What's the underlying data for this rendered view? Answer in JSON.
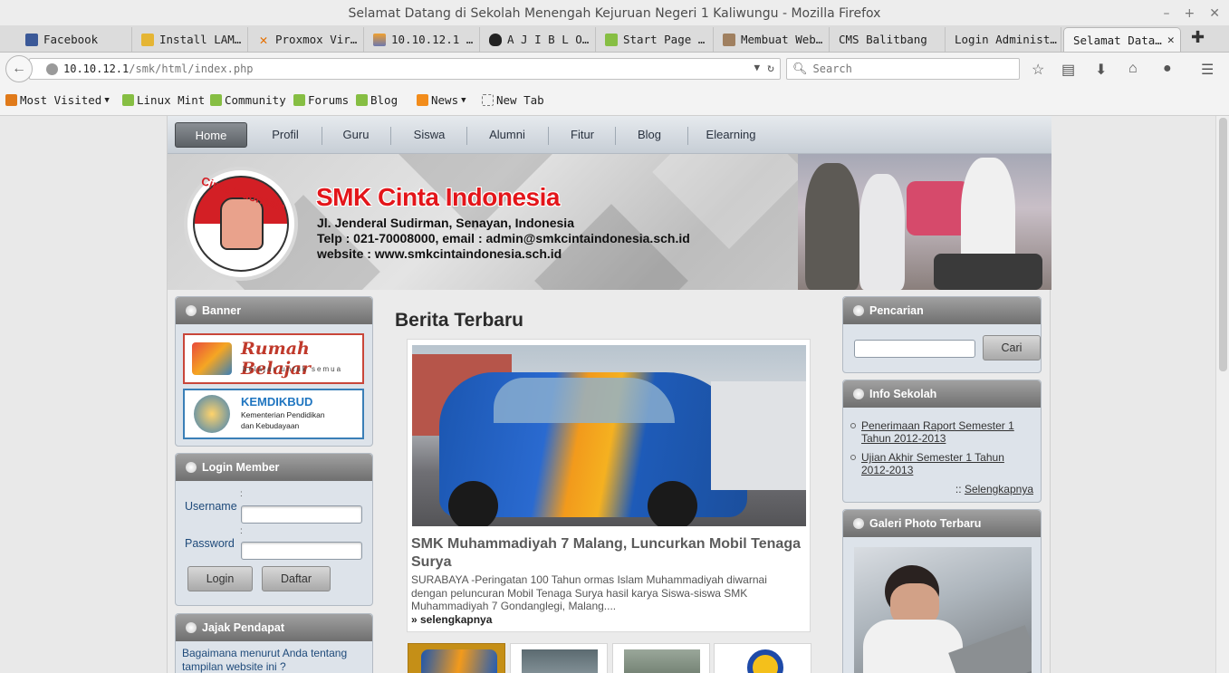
{
  "window": {
    "title": "Selamat Datang di Sekolah Menengah Kejuruan Negeri 1 Kaliwungu - Mozilla Firefox"
  },
  "tabs": [
    {
      "label": "Facebook",
      "icon": "facebook-icon",
      "color": "#3b5998"
    },
    {
      "label": "Install LAM…",
      "icon": "person-icon",
      "color": "#e5b534"
    },
    {
      "label": "Proxmox Vir…",
      "icon": "proxmox-icon",
      "color": "#e57000"
    },
    {
      "label": "10.10.12.1 …",
      "icon": "pma-icon",
      "color": "#f0a030"
    },
    {
      "label": "A J I B L O…",
      "icon": "tux-icon",
      "color": "#333333"
    },
    {
      "label": "Start Page …",
      "icon": "mint-icon",
      "color": "#86be43"
    },
    {
      "label": "Membuat Web…",
      "icon": "page-icon",
      "color": "#a08060"
    },
    {
      "label": "CMS Balitbang",
      "icon": "",
      "color": ""
    },
    {
      "label": "Login Administ…",
      "icon": "",
      "color": ""
    },
    {
      "label": "Selamat Data…",
      "icon": "",
      "color": ""
    }
  ],
  "navbar": {
    "url_host": "10.10.12.1",
    "url_path": "/smk/html/index.php",
    "search_placeholder": "Search"
  },
  "bookmarks": [
    {
      "label": "Most Visited",
      "icon": "most-visited-icon",
      "dropdown": true
    },
    {
      "label": "Linux Mint",
      "icon": "mint-icon",
      "dropdown": false
    },
    {
      "label": "Community",
      "icon": "mint-icon",
      "dropdown": false
    },
    {
      "label": "Forums",
      "icon": "mint-icon",
      "dropdown": false
    },
    {
      "label": "Blog",
      "icon": "mint-icon",
      "dropdown": false
    },
    {
      "label": "News",
      "icon": "rss-icon",
      "dropdown": true
    },
    {
      "label": "New Tab",
      "icon": "new-tab-icon",
      "dropdown": false
    }
  ],
  "site": {
    "menu": [
      "Home",
      "Profil",
      "Guru",
      "Siswa",
      "Alumni",
      "Fitur",
      "Blog",
      "Elearning"
    ],
    "active_menu": "Home",
    "header": {
      "logo_text": "Cinta Indonesia",
      "name": "SMK Cinta Indonesia",
      "address": "Jl. Jenderal Sudirman, Senayan, Indonesia",
      "contact": "Telp : 021-70008000, email : admin@smkcintaindonesia.sch.id",
      "website": "website : www.smkcintaindonesia.sch.id"
    },
    "banner_panel": {
      "title": "Banner",
      "rumah_belajar": {
        "title": "Rumah Belajar",
        "subtitle": "belajar untuk semua"
      },
      "kemdikbud": {
        "title": "KEMDIKBUD",
        "line1": "Kementerian Pendidikan",
        "line2": "dan Kebudayaan"
      }
    },
    "login_panel": {
      "title": "Login Member",
      "username_label": "Username",
      "password_label": "Password",
      "colon": ":",
      "login_button": "Login",
      "register_button": "Daftar"
    },
    "poll_panel": {
      "title": "Jajak Pendapat",
      "question": "Bagaimana menurut Anda tentang tampilan website ini ?"
    },
    "main": {
      "heading": "Berita Terbaru",
      "headline": "SMK Muhammadiyah 7 Malang, Luncurkan Mobil Tenaga Surya",
      "excerpt": "SURABAYA -Peringatan 100 Tahun ormas Islam Muhammadiyah diwarnai dengan peluncuran Mobil Tenaga Surya hasil karya Siswa-siswa SMK Muhammadiyah 7 Gondanglegi, Malang....",
      "read_more": "» selengkapnya"
    },
    "search_panel": {
      "title": "Pencarian",
      "button": "Cari"
    },
    "info_panel": {
      "title": "Info Sekolah",
      "items": [
        "Penerimaan Raport Semester 1 Tahun 2012-2013",
        "Ujian Akhir Semester 1 Tahun 2012-2013"
      ],
      "more_prefix": "::",
      "more": "Selengkapnya"
    },
    "gallery_panel": {
      "title": "Galeri Photo Terbaru"
    }
  }
}
